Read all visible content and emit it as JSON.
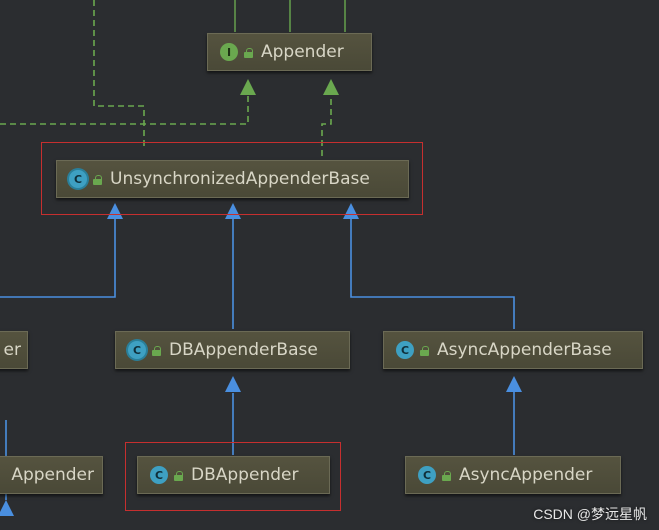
{
  "colors": {
    "background": "#2b2d30",
    "node_fill": "#4f4e3c",
    "class_badge": "#3ea0c2",
    "interface_badge": "#6aa84f",
    "implements_edge": "#6aa84f",
    "extends_edge": "#4a8fe0",
    "highlight_box": "#c62f2f"
  },
  "nodes": {
    "appender": {
      "label": "Appender",
      "badge": "I",
      "badge_icon": "interface-icon"
    },
    "unsync_base": {
      "label": "UnsynchronizedAppenderBase",
      "badge": "C",
      "badge_icon": "abstract-class-icon"
    },
    "partial_left_top": {
      "label": "er",
      "badge_icon": "class-icon"
    },
    "db_base": {
      "label": "DBAppenderBase",
      "badge": "C",
      "badge_icon": "abstract-class-icon"
    },
    "async_base": {
      "label": "AsyncAppenderBase",
      "badge": "C",
      "badge_icon": "class-icon"
    },
    "partial_left_bottom": {
      "label": "Appender",
      "badge_icon": "class-icon"
    },
    "db_appender": {
      "label": "DBAppender",
      "badge": "C",
      "badge_icon": "class-icon"
    },
    "async_appender": {
      "label": "AsyncAppender",
      "badge": "C",
      "badge_icon": "class-icon"
    }
  },
  "watermark": "CSDN @梦远星帆"
}
